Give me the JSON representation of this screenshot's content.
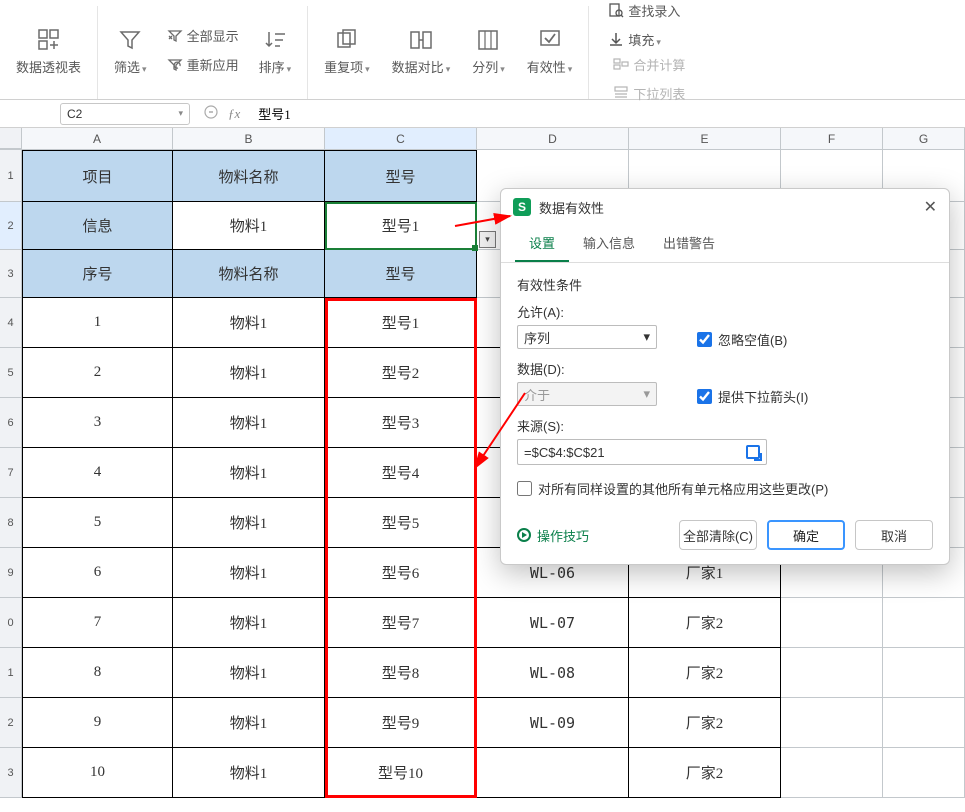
{
  "ribbon": {
    "pivot": "数据透视表",
    "filter": "筛选",
    "show_all": "全部显示",
    "reapply": "重新应用",
    "sort": "排序",
    "dup": "重复项",
    "compare": "数据对比",
    "split": "分列",
    "validity": "有效性",
    "find_entry": "查找录入",
    "fill": "填充",
    "merge_calc": "合并计算",
    "dropdown_list": "下拉列表"
  },
  "namebox": "C2",
  "formula": "型号1",
  "columns": [
    "A",
    "B",
    "C",
    "D",
    "E",
    "F",
    "G"
  ],
  "col_sel": "C",
  "row_sel": "2",
  "header_row": {
    "A": "项目",
    "B": "物料名称",
    "C": "型号"
  },
  "info_row": {
    "A": "信息",
    "B": "物料1",
    "C": "型号1"
  },
  "header_row2": {
    "A": "序号",
    "B": "物料名称",
    "C": "型号"
  },
  "data": [
    {
      "n": "1",
      "mat": "物料1",
      "model": "型号1",
      "code": "",
      "mfr": ""
    },
    {
      "n": "2",
      "mat": "物料1",
      "model": "型号2",
      "code": "",
      "mfr": ""
    },
    {
      "n": "3",
      "mat": "物料1",
      "model": "型号3",
      "code": "",
      "mfr": ""
    },
    {
      "n": "4",
      "mat": "物料1",
      "model": "型号4",
      "code": "",
      "mfr": ""
    },
    {
      "n": "5",
      "mat": "物料1",
      "model": "型号5",
      "code": "",
      "mfr": ""
    },
    {
      "n": "6",
      "mat": "物料1",
      "model": "型号6",
      "code": "WL-06",
      "mfr": "厂家1"
    },
    {
      "n": "7",
      "mat": "物料1",
      "model": "型号7",
      "code": "WL-07",
      "mfr": "厂家2"
    },
    {
      "n": "8",
      "mat": "物料1",
      "model": "型号8",
      "code": "WL-08",
      "mfr": "厂家2"
    },
    {
      "n": "9",
      "mat": "物料1",
      "model": "型号9",
      "code": "WL-09",
      "mfr": "厂家2"
    },
    {
      "n": "10",
      "mat": "物料1",
      "model": "型号10",
      "code": "",
      "mfr": "厂家2"
    }
  ],
  "row_numbers": [
    "1",
    "2",
    "3",
    "4",
    "5",
    "6",
    "7",
    "8",
    "9",
    "0",
    "1",
    "2"
  ],
  "dialog": {
    "title": "数据有效性",
    "tabs": {
      "settings": "设置",
      "input": "输入信息",
      "error": "出错警告"
    },
    "cond_title": "有效性条件",
    "allow_label": "允许(A):",
    "allow_value": "序列",
    "data_label": "数据(D):",
    "data_value": "介于",
    "source_label": "来源(S):",
    "source_value": "=$C$4:$C$21",
    "ignore_blank": "忽略空值(B)",
    "show_dd": "提供下拉箭头(I)",
    "apply_same": "对所有同样设置的其他所有单元格应用这些更改(P)",
    "tips": "操作技巧",
    "clear_all": "全部清除(C)",
    "ok": "确定",
    "cancel": "取消"
  }
}
